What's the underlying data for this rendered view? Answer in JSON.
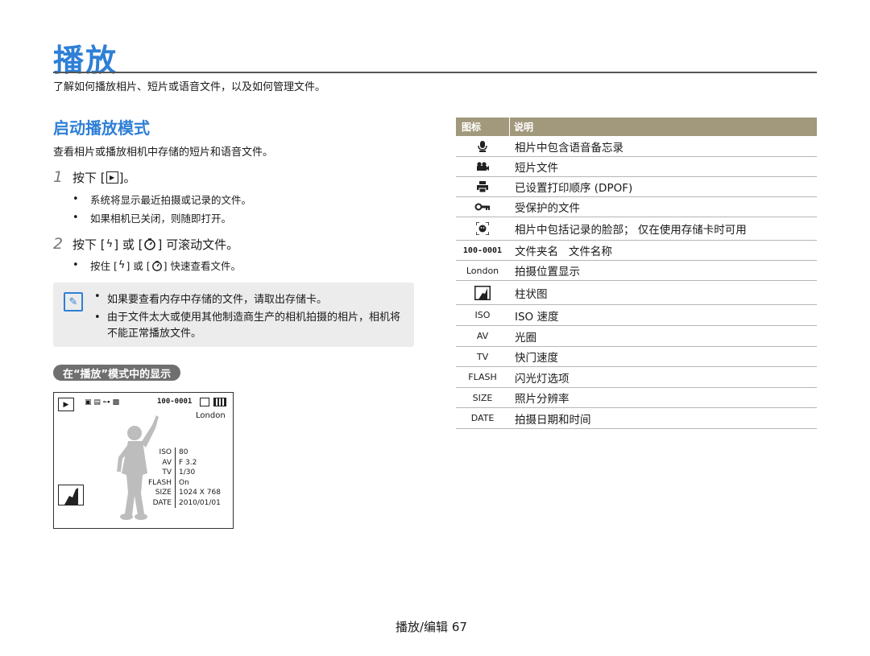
{
  "page": {
    "title": "播放",
    "intro": "了解如何播放相片、短片或语音文件，以及如何管理文件。",
    "section_title": "启动播放模式",
    "section_desc": "查看相片或播放相机中存储的短片和语音文件。",
    "footer": "播放/编辑 67"
  },
  "steps": [
    {
      "num": "1",
      "pre": "按下 [",
      "post": "]。",
      "bullets": [
        "系统将显示最近拍摄或记录的文件。",
        "如果相机已关闭，则随即打开。"
      ]
    },
    {
      "num": "2",
      "pre": "按下 [",
      "mid": "] 或 [",
      "post": "] 可滚动文件。",
      "bullets_pre": "按住 [",
      "bullets_mid": "] 或 [",
      "bullets_post": "] 快速查看文件。"
    }
  ],
  "note": {
    "items": [
      "如果要查看内存中存储的文件，请取出存储卡。",
      "由于文件太大或使用其他制造商生产的相机拍摄的相片，相机将不能正常播放文件。"
    ]
  },
  "display_section": {
    "title": "在“播放”模式中的显示"
  },
  "camera_screen": {
    "file_number": "100-0001",
    "location": "London",
    "labels": [
      "ISO",
      "AV",
      "TV",
      "FLASH",
      "SIZE",
      "DATE"
    ],
    "values": [
      "80",
      "F 3.2",
      "1/30",
      "On",
      "1024 X 768",
      "2010/01/01"
    ]
  },
  "table": {
    "header_icon": "图标",
    "header_desc": "说明",
    "rows": [
      {
        "icon": "microphone-icon",
        "label": "",
        "desc": "相片中包含语音备忘录"
      },
      {
        "icon": "movie-camera-icon",
        "label": "",
        "desc": "短片文件"
      },
      {
        "icon": "printer-icon",
        "label": "",
        "desc": "已设置打印顺序 (DPOF)"
      },
      {
        "icon": "key-icon",
        "label": "",
        "desc": "受保护的文件"
      },
      {
        "icon": "face-icon",
        "label": "",
        "desc": "相片中包括记录的脸部； 仅在使用存储卡时可用"
      },
      {
        "icon": "",
        "label": "100-0001",
        "desc": "文件夹名   文件名称"
      },
      {
        "icon": "",
        "label": "London",
        "desc": "拍摄位置显示"
      },
      {
        "icon": "histogram-icon",
        "label": "",
        "desc": "柱状图"
      },
      {
        "icon": "",
        "label": "ISO",
        "desc": "ISO 速度"
      },
      {
        "icon": "",
        "label": "AV",
        "desc": "光圈"
      },
      {
        "icon": "",
        "label": "TV",
        "desc": "快门速度"
      },
      {
        "icon": "",
        "label": "FLASH",
        "desc": "闪光灯选项"
      },
      {
        "icon": "",
        "label": "SIZE",
        "desc": "照片分辨率"
      },
      {
        "icon": "",
        "label": "DATE",
        "desc": "拍摄日期和时间"
      }
    ]
  },
  "colors": {
    "accent": "#2f7fd6",
    "table_header": "#a2987c",
    "note_bg": "#ececec",
    "pill": "#6f6f6f"
  }
}
